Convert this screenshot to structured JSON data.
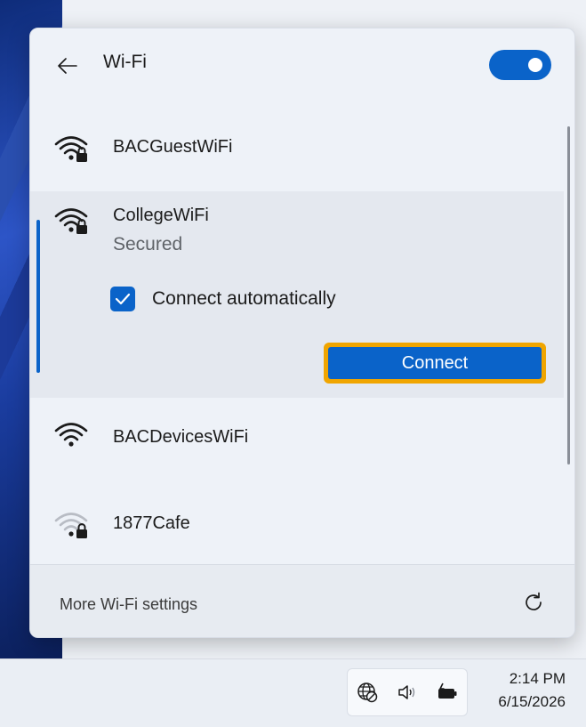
{
  "header": {
    "title": "Wi-Fi",
    "back_icon": "arrow-left-icon",
    "wifi_enabled": true
  },
  "networks": [
    {
      "name": "BACGuestWiFi",
      "secured": true,
      "signal": "full"
    },
    {
      "name": "CollegeWiFi",
      "status": "Secured",
      "secured": true,
      "signal": "full",
      "selected": true,
      "connect_automatically_label": "Connect automatically",
      "connect_automatically": true,
      "connect_label": "Connect"
    },
    {
      "name": "BACDevicesWiFi",
      "secured": false,
      "signal": "full"
    },
    {
      "name": "1877Cafe",
      "secured": true,
      "signal": "weak"
    }
  ],
  "footer": {
    "more_settings_label": "More Wi-Fi settings",
    "refresh_icon": "refresh-icon"
  },
  "taskbar": {
    "tray_icons": [
      "globe-no-internet-icon",
      "speaker-icon",
      "battery-charging-icon"
    ],
    "time": "2:14 PM",
    "date": "6/15/2026"
  },
  "colors": {
    "accent": "#0a63c9",
    "focus_ring": "#f0a500",
    "panel_bg": "#eef2f8",
    "selected_bg": "#e4e8ef"
  }
}
